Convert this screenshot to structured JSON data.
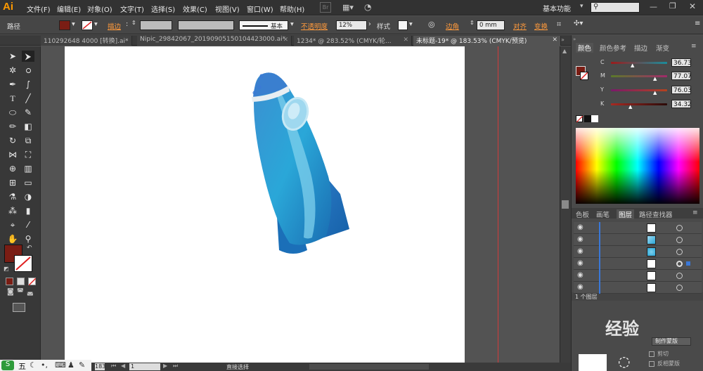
{
  "app": {
    "logo": "Ai",
    "menus": [
      "文件(F)",
      "编辑(E)",
      "对象(O)",
      "文字(T)",
      "选择(S)",
      "效果(C)",
      "视图(V)",
      "窗口(W)",
      "帮助(H)"
    ],
    "workspace_label": "基本功能",
    "bridge_label": "Br"
  },
  "control": {
    "selection_label": "路径",
    "stroke_label": "描边",
    "stroke_profile": "基本",
    "opacity_label": "不透明度",
    "opacity_value": "12%",
    "style_label": "样式",
    "corner_label": "边角",
    "corner_value": "0 mm",
    "align_label": "对齐",
    "transform_label": "变换",
    "fill_color": "#7a1d14"
  },
  "tabs": [
    {
      "label": "110292648 4000 [转换].ai*"
    },
    {
      "label": "Nipic_29842067_20190905150104423000.ai*"
    },
    {
      "label": "1234* @ 283.52% (CMYK/轮..."
    },
    {
      "label": "未标题-19* @ 183.53% (CMYK/预览)"
    }
  ],
  "status": {
    "zoom": "183",
    "page": "1",
    "tool_status": "直接选择"
  },
  "color_panel": {
    "tabs": [
      "颜色",
      "颜色参考",
      "描边",
      "渐变"
    ],
    "channels": [
      {
        "name": "C",
        "value": "36.73"
      },
      {
        "name": "M",
        "value": "77.07"
      },
      {
        "name": "Y",
        "value": "76.03"
      },
      {
        "name": "K",
        "value": "34.32"
      }
    ]
  },
  "layers_panel": {
    "tabs": [
      "色板",
      "画笔",
      "图层",
      "路径查找器"
    ],
    "footer": "1 个图层"
  },
  "transparency_panel": {
    "make_mask": "制作蒙版",
    "clip": "剪切",
    "invert_mask": "反相蒙版"
  },
  "watermark": {
    "text": "经验"
  },
  "taskbar": {
    "ime": "五"
  }
}
